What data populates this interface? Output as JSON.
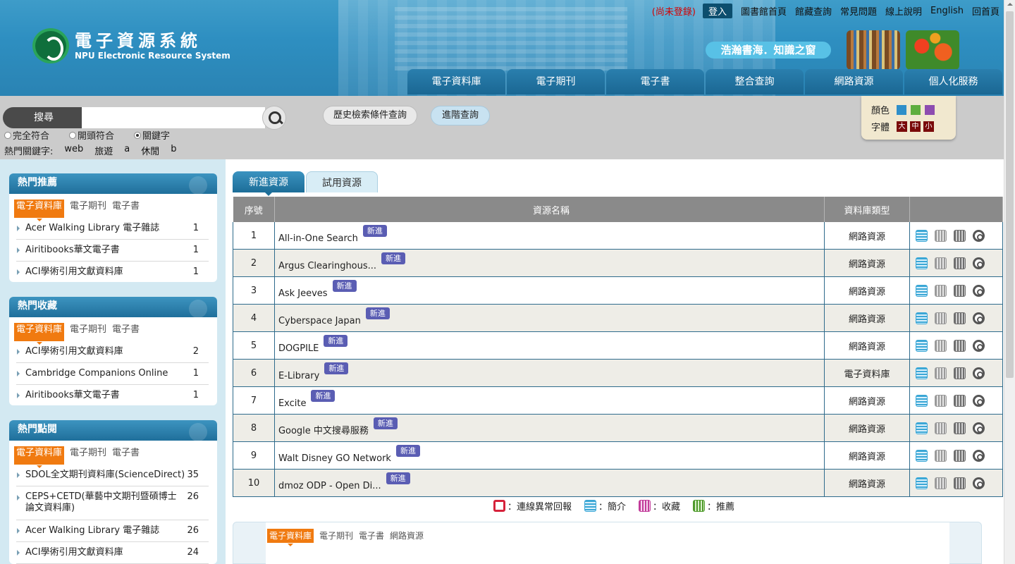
{
  "header": {
    "logo_cn": "電子資源系統",
    "logo_en": "NPU Electronic Resource System",
    "not_logged": "(尚未登錄)",
    "login": "登入",
    "links": [
      "圖書館首頁",
      "館藏查詢",
      "常見問題",
      "線上說明",
      "English",
      "回首頁"
    ],
    "slogan": "浩瀚書海．知識之窗",
    "nav": [
      "電子資料庫",
      "電子期刊",
      "電子書",
      "整合查詢",
      "網路資源",
      "個人化服務"
    ]
  },
  "search": {
    "label": "搜尋",
    "value": "",
    "options": [
      "完全符合",
      "開頭符合",
      "關鍵字"
    ],
    "selected": "關鍵字",
    "hot_label": "熱門關鍵字:",
    "hot_keywords": [
      "web",
      "旅遊",
      "a",
      "休閒",
      "b"
    ],
    "history_btn": "歷史檢索條件查詢",
    "advanced_btn": "進階查詢"
  },
  "style_box": {
    "color_label": "顏色",
    "colors": [
      "#2f8fc9",
      "#5fae3e",
      "#8d4cb0"
    ],
    "font_label": "字體",
    "font_sizes": [
      "大",
      "中",
      "小"
    ]
  },
  "sidebar": {
    "sub_tabs": [
      "電子資料庫",
      "電子期刊",
      "電子書"
    ],
    "panels": [
      {
        "title": "熱門推薦",
        "items": [
          {
            "name": "Acer Walking Library 電子雜誌",
            "count": "1"
          },
          {
            "name": "Airitibooks華文電子書",
            "count": "1"
          },
          {
            "name": "ACI學術引用文獻資料庫",
            "count": "1"
          }
        ]
      },
      {
        "title": "熱門收藏",
        "items": [
          {
            "name": "ACI學術引用文獻資料庫",
            "count": "2"
          },
          {
            "name": "Cambridge Companions Online",
            "count": "1"
          },
          {
            "name": "Airitibooks華文電子書",
            "count": "1"
          }
        ]
      },
      {
        "title": "熱門點閱",
        "items": [
          {
            "name": "SDOL全文期刊資料庫(ScienceDirect)",
            "count": "35"
          },
          {
            "name": "CEPS+CETD(華藝中文期刊暨碩博士論文資料庫)",
            "count": "26"
          },
          {
            "name": "Acer Walking Library 電子雜誌",
            "count": "26"
          },
          {
            "name": "ACI學術引用文獻資料庫",
            "count": "24"
          }
        ]
      }
    ]
  },
  "main": {
    "tabs": [
      "新進資源",
      "試用資源"
    ],
    "columns": [
      "序號",
      "資源名稱",
      "資料庫類型",
      ""
    ],
    "new_badge": "新進",
    "rows": [
      {
        "no": "1",
        "name": "All-in-One Search",
        "type": "網路資源"
      },
      {
        "no": "2",
        "name": "Argus Clearinghous...",
        "type": "網路資源"
      },
      {
        "no": "3",
        "name": "Ask Jeeves",
        "type": "網路資源"
      },
      {
        "no": "4",
        "name": "Cyberspace Japan",
        "type": "網路資源"
      },
      {
        "no": "5",
        "name": "DOGPILE",
        "type": "網路資源"
      },
      {
        "no": "6",
        "name": "E-Library",
        "type": "電子資料庫"
      },
      {
        "no": "7",
        "name": "Excite",
        "type": "網路資源"
      },
      {
        "no": "8",
        "name": "Google 中文搜尋服務",
        "type": "網路資源"
      },
      {
        "no": "9",
        "name": "Walt Disney GO Network",
        "type": "網路資源"
      },
      {
        "no": "10",
        "name": "dmoz ODP - Open Di...",
        "type": "網路資源"
      }
    ],
    "legend": [
      {
        "icon": "report-icon",
        "label": "：連線異常回報"
      },
      {
        "icon": "intro-icon",
        "label": "：簡介"
      },
      {
        "icon": "favorite-icon",
        "label": "：收藏"
      },
      {
        "icon": "recommend-icon",
        "label": "：推薦"
      }
    ],
    "bottom_tabs": [
      "電子資料庫",
      "電子期刊",
      "電子書",
      "網路資源"
    ]
  }
}
